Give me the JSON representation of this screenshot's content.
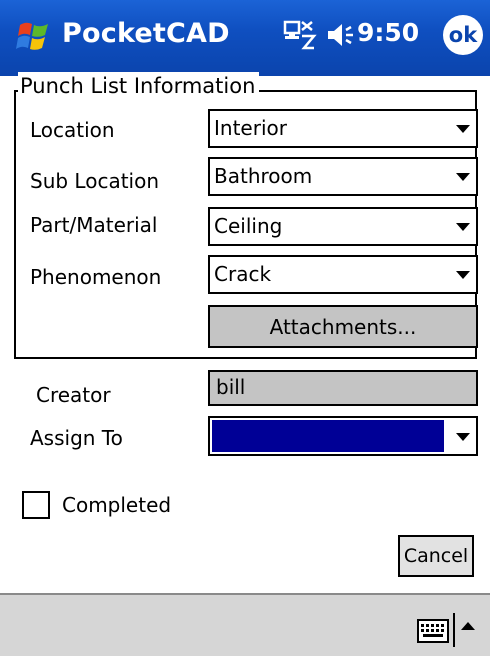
{
  "title_bar": {
    "app_title": "PocketCAD",
    "time": "9:50",
    "ok_label": "ok"
  },
  "group": {
    "title": "Punch List Information"
  },
  "fields": {
    "location": {
      "label": "Location",
      "value": "Interior"
    },
    "sub_location": {
      "label": "Sub Location",
      "value": "Bathroom"
    },
    "part_material": {
      "label": "Part/Material",
      "value": "Ceiling"
    },
    "phenomenon": {
      "label": "Phenomenon",
      "value": "Crack"
    },
    "attachments_label": "Attachments...",
    "creator": {
      "label": "Creator",
      "value": "bill"
    },
    "assign_to": {
      "label": "Assign To",
      "value": ""
    }
  },
  "completed": {
    "label": "Completed",
    "checked": false
  },
  "buttons": {
    "cancel": "Cancel"
  },
  "colors": {
    "title_bar": "#0f4fc0",
    "selection": "#000096",
    "disabled_field": "#c4c4c4",
    "menu_bar": "#d6d6d6"
  },
  "icons": [
    "windows-start-icon",
    "connectivity-icon",
    "speaker-icon",
    "ok-icon",
    "keyboard-icon",
    "sip-arrow-icon"
  ]
}
